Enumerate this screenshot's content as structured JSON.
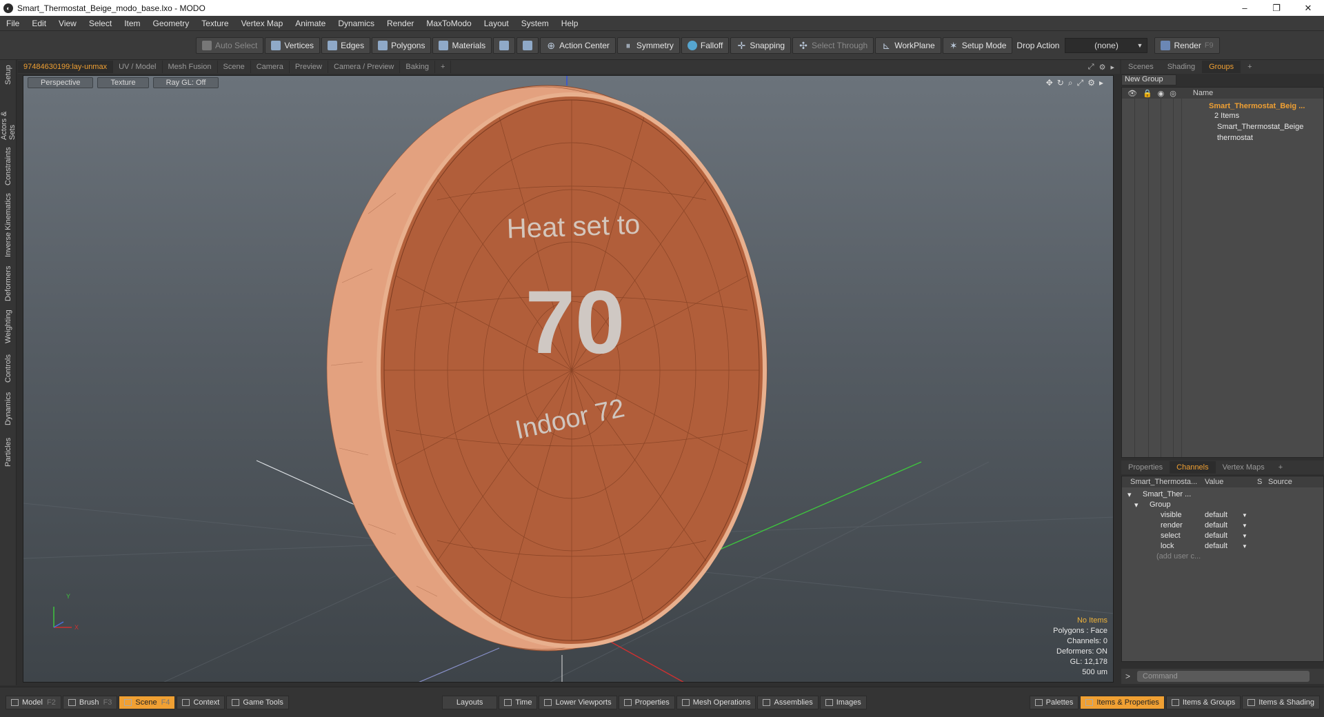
{
  "window": {
    "title": "Smart_Thermostat_Beige_modo_base.lxo - MODO",
    "min": "–",
    "max": "❐",
    "close": "✕"
  },
  "menu": [
    "File",
    "Edit",
    "View",
    "Select",
    "Item",
    "Geometry",
    "Texture",
    "Vertex Map",
    "Animate",
    "Dynamics",
    "Render",
    "MaxToModo",
    "Layout",
    "System",
    "Help"
  ],
  "toolbar": {
    "auto_select": "Auto Select",
    "vertices": "Vertices",
    "edges": "Edges",
    "polygons": "Polygons",
    "materials": "Materials",
    "action_center": "Action Center",
    "symmetry": "Symmetry",
    "falloff": "Falloff",
    "snapping": "Snapping",
    "select_through": "Select Through",
    "workplane": "WorkPlane",
    "setup_mode": "Setup Mode",
    "drop_action_label": "Drop Action",
    "drop_action_value": "(none)",
    "render": "Render",
    "render_key": "F9"
  },
  "left_tabs": [
    "Setup",
    "Actors & Sets",
    "Constraints",
    "Inverse Kinematics",
    "Deformers",
    "Weighting",
    "Controls",
    "Dynamics",
    "Particles"
  ],
  "viewport_tabs": [
    "97484630199:lay-unmax",
    "UV / Model",
    "Mesh Fusion",
    "Scene",
    "Camera",
    "Preview",
    "Camera / Preview",
    "Baking",
    "+"
  ],
  "viewport": {
    "perspective": "Perspective",
    "texture": "Texture",
    "raygl": "Ray GL: Off",
    "thermostat_text_top": "Heat set to",
    "thermostat_text_big": "70",
    "thermostat_text_bottom": "Indoor 72",
    "hud": {
      "items": "No Items",
      "polygons": "Polygons : Face",
      "channels": "Channels: 0",
      "deformers": "Deformers: ON",
      "gl": "GL: 12,178",
      "unit": "500 um"
    }
  },
  "right_tabs": [
    "Scenes",
    "Shading",
    "Groups",
    "+"
  ],
  "groups_panel": {
    "new_group": "New Group",
    "name_header": "Name",
    "group_name": "Smart_Thermostat_Beig ...",
    "group_count": "2 Items",
    "children": [
      "Smart_Thermostat_Beige",
      "thermostat"
    ]
  },
  "channel_tabs": [
    "Properties",
    "Channels",
    "Vertex Maps",
    "+"
  ],
  "channels_panel": {
    "col_name": "Smart_Thermosta...",
    "col_value": "Value",
    "col_s": "S",
    "col_source": "Source",
    "root": "Smart_Ther ...",
    "group": "Group",
    "rows": [
      {
        "name": "visible",
        "value": "default"
      },
      {
        "name": "render",
        "value": "default"
      },
      {
        "name": "select",
        "value": "default"
      },
      {
        "name": "lock",
        "value": "default"
      }
    ],
    "add_user": "(add user c..."
  },
  "command": {
    "prompt": ">",
    "placeholder": "Command"
  },
  "bottom_left": [
    {
      "label": "Model",
      "key": "F2"
    },
    {
      "label": "Brush",
      "key": "F3"
    },
    {
      "label": "Scene",
      "key": "F4",
      "active": true
    },
    {
      "label": "Context",
      "key": ""
    },
    {
      "label": "Game Tools",
      "key": ""
    }
  ],
  "bottom_mid": [
    "Layouts",
    "Time",
    "Lower Viewports",
    "Properties",
    "Mesh Operations",
    "Assemblies",
    "Images"
  ],
  "bottom_right": [
    "Palettes",
    "Items & Properties",
    "Items & Groups",
    "Items & Shading"
  ],
  "colors": {
    "accent": "#f0a033",
    "thermostat_face": "#b5603b",
    "thermostat_rim": "#dd9d7a"
  }
}
